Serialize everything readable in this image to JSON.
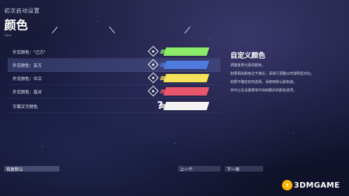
{
  "header": {
    "subtitle": "初次启动设置",
    "title": "颜色",
    "tiny": "Color"
  },
  "rows": [
    {
      "label": "外交颜色：\"己方\"",
      "color": "#8cec6a",
      "icon": "◆"
    },
    {
      "label": "外交颜色：友方",
      "color": "#4f7be0",
      "icon": "◆"
    },
    {
      "label": "外交颜色：中立",
      "color": "#f3e25a",
      "icon": "◆"
    },
    {
      "label": "外交颜色：敌对",
      "color": "#e8566c",
      "icon": "◆"
    },
    {
      "label": "字幕文字颜色",
      "color": "#f3f3f3",
      "icon": "?"
    }
  ],
  "info": {
    "title": "自定义颜色",
    "line1": "调整各类元素的颜色。",
    "line2": "如果相关颜色过于接近，请进行调整以形成明显对比。",
    "line3": "如果不确定如何选择，请使用默认颜色值。",
    "line4": "你可以在设置菜单中找到额外的颜色选项。"
  },
  "footer": {
    "reset": "恢复默认",
    "prev": "上一个",
    "next": "下一项"
  },
  "watermark": {
    "badge": "3",
    "text": "3DMGAME"
  }
}
